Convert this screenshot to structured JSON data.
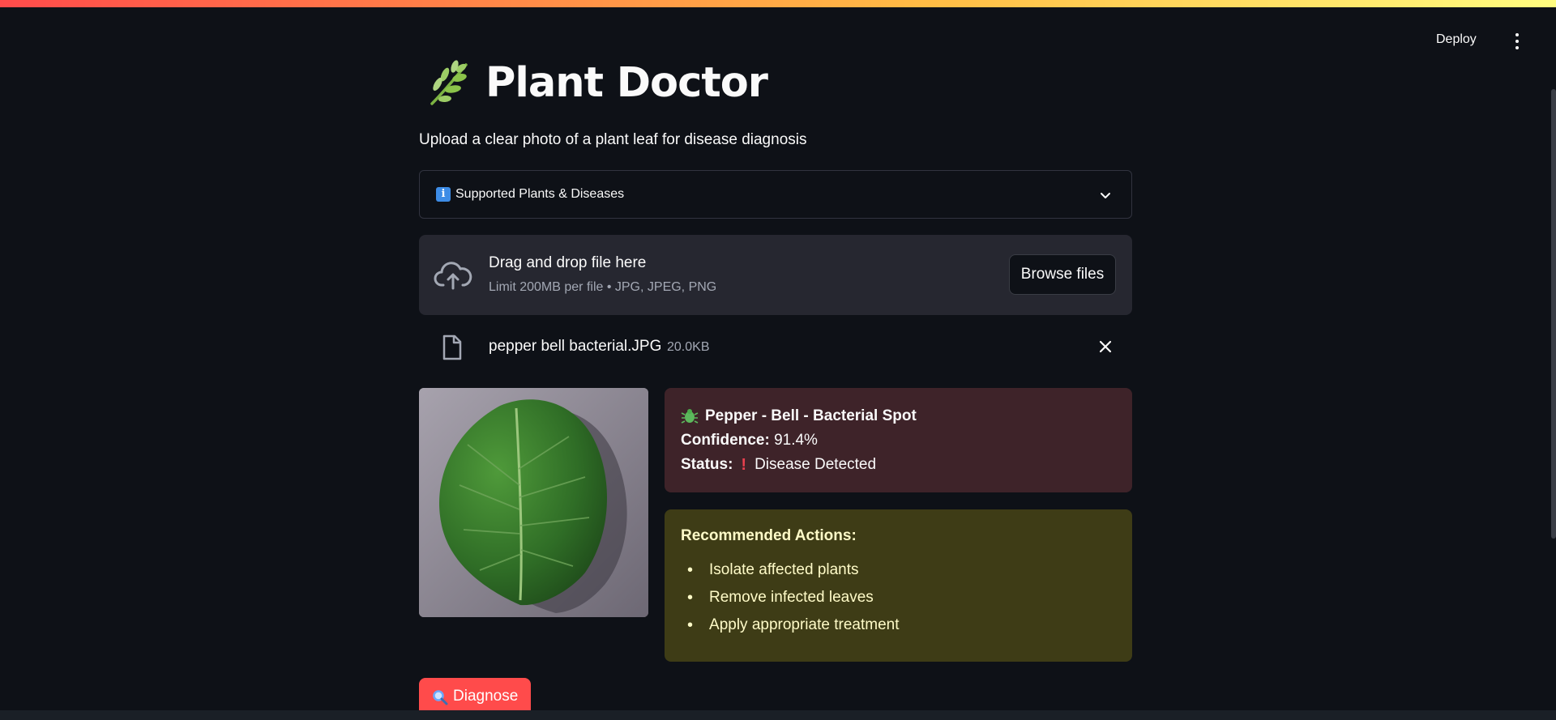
{
  "header": {
    "deploy_label": "Deploy"
  },
  "page": {
    "title": "Plant Doctor",
    "subtitle": "Upload a clear photo of a plant leaf for disease diagnosis"
  },
  "expander": {
    "icon": "info-icon",
    "label": "Supported Plants & Diseases"
  },
  "uploader": {
    "title": "Drag and drop file here",
    "limit": "Limit 200MB per file • JPG, JPEG, PNG",
    "browse_label": "Browse files"
  },
  "uploaded_file": {
    "name": "pepper bell bacterial.JPG",
    "size": "20.0KB"
  },
  "result": {
    "diagnosis": "Pepper - Bell - Bacterial Spot",
    "confidence_label": "Confidence:",
    "confidence_value": "91.4%",
    "status_label": "Status:",
    "status_value": "Disease Detected",
    "status_color": "#e8404e",
    "background": "#3e2329"
  },
  "actions": {
    "title": "Recommended Actions:",
    "items": [
      "Isolate affected plants",
      "Remove infected leaves",
      "Apply appropriate treatment"
    ],
    "background": "#3e3c16"
  },
  "diagnose_button": {
    "label": "Diagnose",
    "color": "#ff4b4b"
  },
  "colors": {
    "background": "#0e1117",
    "accent": "#ff4b4b"
  }
}
